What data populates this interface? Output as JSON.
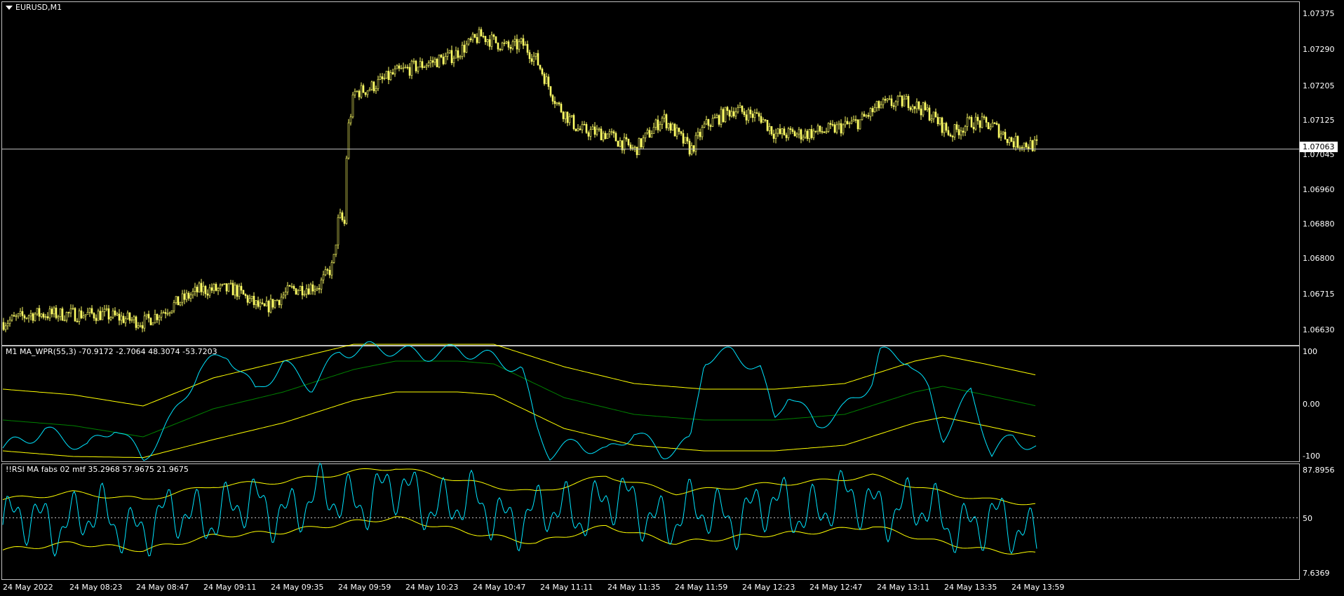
{
  "main_chart": {
    "title": "EURUSD,M1",
    "current_price": "1.07063",
    "y_labels": [
      "1.07375",
      "1.07290",
      "1.07205",
      "1.07125",
      "1.07045",
      "1.06960",
      "1.06880",
      "1.06800",
      "1.06715",
      "1.06630"
    ],
    "candle_color": "#ffff66",
    "ylim": [
      1.0659,
      1.0742
    ],
    "price_path_keys": [
      [
        0,
        1.0664
      ],
      [
        40,
        1.0666
      ],
      [
        80,
        1.0666
      ],
      [
        140,
        1.0666
      ],
      [
        200,
        1.0664
      ],
      [
        240,
        1.0668
      ],
      [
        280,
        1.0672
      ],
      [
        330,
        1.0672
      ],
      [
        370,
        1.0667
      ],
      [
        410,
        1.0672
      ],
      [
        450,
        1.0673
      ],
      [
        470,
        1.0678
      ],
      [
        478,
        1.069
      ],
      [
        486,
        1.0688
      ],
      [
        490,
        1.071
      ],
      [
        500,
        1.072
      ],
      [
        520,
        1.0721
      ],
      [
        560,
        1.0725
      ],
      [
        600,
        1.0727
      ],
      [
        640,
        1.0729
      ],
      [
        680,
        1.0734
      ],
      [
        720,
        1.0731
      ],
      [
        740,
        1.0732
      ],
      [
        760,
        1.0728
      ],
      [
        790,
        1.0717
      ],
      [
        820,
        1.0711
      ],
      [
        860,
        1.071
      ],
      [
        900,
        1.0706
      ],
      [
        940,
        1.0714
      ],
      [
        980,
        1.0706
      ],
      [
        1000,
        1.0712
      ],
      [
        1040,
        1.0716
      ],
      [
        1080,
        1.0714
      ],
      [
        1100,
        1.071
      ],
      [
        1140,
        1.071
      ],
      [
        1180,
        1.0711
      ],
      [
        1220,
        1.0713
      ],
      [
        1250,
        1.0717
      ],
      [
        1290,
        1.0718
      ],
      [
        1320,
        1.0715
      ],
      [
        1350,
        1.071
      ],
      [
        1380,
        1.0713
      ],
      [
        1410,
        1.0712
      ],
      [
        1440,
        1.0708
      ],
      [
        1476,
        1.0707
      ]
    ]
  },
  "wpr_panel": {
    "title": "M1 MA_WPR(55,3) -70.9172 -2.7064 48.3074 -53.7203",
    "y_labels": [
      "100",
      "0.00",
      "-100"
    ],
    "ylim": [
      -100,
      100
    ],
    "line_color": "#00e5ff",
    "band_color": "#ffff00",
    "mid_color": "#008000"
  },
  "rsi_panel": {
    "title": "!!RSI MA fabs 02 mtf 35.2968 57.9675 21.9675",
    "y_labels": [
      "87.8956",
      "50",
      "7.6369"
    ],
    "ylim": [
      7.6369,
      87.8956
    ],
    "line_color": "#00e5ff",
    "band_color": "#ffff00"
  },
  "x_axis": {
    "labels": [
      "24 May 2022",
      "24 May 08:23",
      "24 May 08:47",
      "24 May 09:11",
      "24 May 09:35",
      "24 May 09:59",
      "24 May 10:23",
      "24 May 10:47",
      "24 May 11:11",
      "24 May 11:35",
      "24 May 11:59",
      "24 May 12:23",
      "24 May 12:47",
      "24 May 13:11",
      "24 May 13:35",
      "24 May 13:59"
    ]
  }
}
